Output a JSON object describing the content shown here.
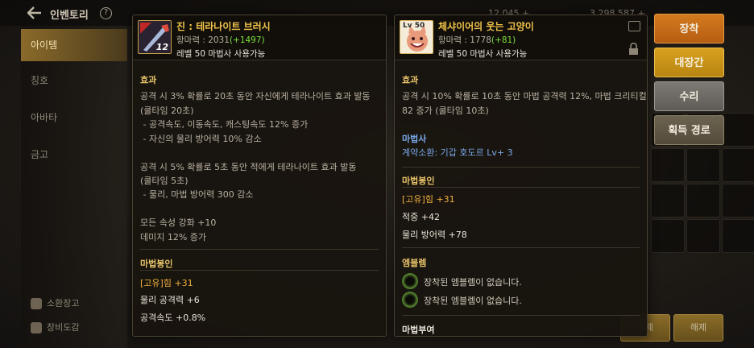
{
  "header": {
    "title": "인벤토리",
    "help": "?",
    "stats": [
      "12,045 +",
      "3,298,587 +"
    ]
  },
  "sidebar": {
    "tabs": [
      {
        "label": "아이템",
        "active": true
      },
      {
        "label": "칭호",
        "active": false
      },
      {
        "label": "아바타",
        "active": false
      },
      {
        "label": "금고",
        "active": false
      }
    ],
    "footer": [
      "소환장고",
      "장비도감"
    ]
  },
  "bottom_buttons": [
    "해제",
    "해제"
  ],
  "left_item": {
    "icon_level": "12",
    "name": "진 : 테라나이트 브러시",
    "attack_label": "항마력 : 2031",
    "attack_bonus": "(+1497)",
    "requirement": "레벨 50 마법사 사용가능",
    "effect_title": "효과",
    "effect_lines": [
      "공격 시 3% 확률로 20초 동안 자신에게 테라나이트 효과 발동",
      "(쿨타임 20초)",
      " - 공격속도, 이동속도, 캐스팅속도 12% 증가",
      " - 자신의 물리 방어력 10% 감소",
      "",
      "공격 시 5% 확률로 5초 동안 적에게 테라나이트 효과 발동",
      "(쿨타임 5초)",
      " - 물리, 마법 방어력 300 감소",
      "",
      "모든 속성 강화 +10",
      "데미지 12% 증가"
    ],
    "seal_title": "마법봉인",
    "seal_lines": [
      "[고유]힘 +31",
      "물리 공격력 +6",
      "공격속도 +0.8%"
    ]
  },
  "right_item": {
    "icon_level": "Lv 50",
    "name": "체샤이어의 웃는 고양이",
    "attack_label": "항마력 : 1778",
    "attack_bonus": "(+81)",
    "requirement": "레벨 50 마법사 사용가능",
    "effect_title": "효과",
    "effect_lines": [
      "공격 시 10% 확률로 10초 동안 마법 공격력 12%, 마법 크리티컬",
      "82 증가 (쿨타임 10초)"
    ],
    "class_title": "마법사",
    "class_line": "계약소환: 기갑 호도르 Lv+ 3",
    "seal_title": "마법봉인",
    "seal_lines": [
      "[고유]힘 +31",
      "적중 +42",
      "물리 방어력 +78"
    ],
    "emblem_title": "엠블렘",
    "emblem_lines": [
      "장착된 엠블렘이 없습니다.",
      "장착된 엠블렘이 없습니다."
    ],
    "enchant_title": "마법부여"
  },
  "actions": {
    "equip": "장착",
    "smith": "대장간",
    "repair": "수리",
    "source": "획득 경로"
  },
  "colors": {
    "item_name": "#f0c34a",
    "bonus": "#7ee03c",
    "section": "#e9c46a",
    "class_blue": "#7aa9e8",
    "equip_btn": "#d37a1f",
    "smith_btn": "#d8a01f"
  }
}
